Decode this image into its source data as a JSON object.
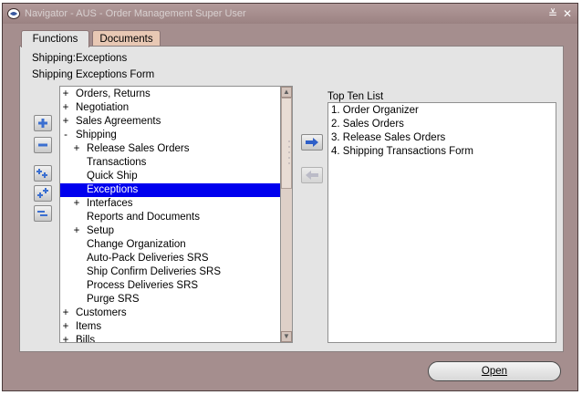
{
  "window": {
    "title": "Navigator - AUS - Order Management Super User",
    "minimize_glyph": "≚",
    "close_glyph": "✕"
  },
  "tabs": [
    {
      "label": "Functions",
      "active": true
    },
    {
      "label": "Documents",
      "active": false
    }
  ],
  "header": {
    "line1": "Shipping:Exceptions",
    "line2": "Shipping Exceptions Form"
  },
  "tree": {
    "items": [
      {
        "sign": "+",
        "label": "Orders, Returns",
        "indent": 0
      },
      {
        "sign": "+",
        "label": "Negotiation",
        "indent": 0
      },
      {
        "sign": "+",
        "label": "Sales Agreements",
        "indent": 0
      },
      {
        "sign": "-",
        "label": "Shipping",
        "indent": 0
      },
      {
        "sign": "+",
        "label": "Release Sales Orders",
        "indent": 1
      },
      {
        "sign": "",
        "label": "Transactions",
        "indent": 1
      },
      {
        "sign": "",
        "label": "Quick Ship",
        "indent": 1
      },
      {
        "sign": "",
        "label": "Exceptions",
        "indent": 1,
        "selected": true
      },
      {
        "sign": "+",
        "label": "Interfaces",
        "indent": 1
      },
      {
        "sign": "",
        "label": "Reports and Documents",
        "indent": 1
      },
      {
        "sign": "+",
        "label": "Setup",
        "indent": 1
      },
      {
        "sign": "",
        "label": "Change Organization",
        "indent": 1
      },
      {
        "sign": "",
        "label": "Auto-Pack Deliveries SRS",
        "indent": 1
      },
      {
        "sign": "",
        "label": "Ship Confirm Deliveries SRS",
        "indent": 1
      },
      {
        "sign": "",
        "label": "Process Deliveries SRS",
        "indent": 1
      },
      {
        "sign": "",
        "label": "Purge SRS",
        "indent": 1
      },
      {
        "sign": "+",
        "label": "Customers",
        "indent": 0
      },
      {
        "sign": "+",
        "label": "Items",
        "indent": 0
      },
      {
        "sign": "+",
        "label": "Bills",
        "indent": 0
      }
    ]
  },
  "top_ten": {
    "label": "Top Ten List",
    "items": [
      "1. Order Organizer",
      "2. Sales Orders",
      "3. Release Sales Orders",
      "4. Shipping Transactions Form"
    ]
  },
  "buttons": {
    "open_label": "Open"
  },
  "colors": {
    "window_bg": "#a58e8e",
    "panel_bg": "#e4e4e4",
    "selection": "#0000ee",
    "documents_tab": "#e8c8b4"
  }
}
